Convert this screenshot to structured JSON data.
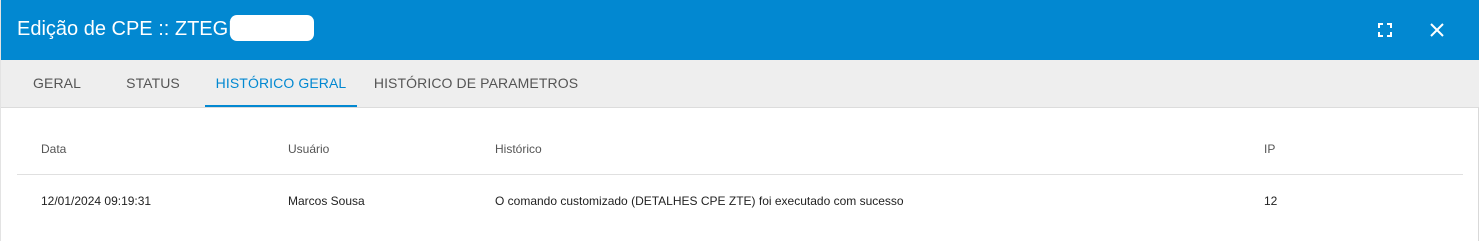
{
  "dialog": {
    "title": "Edição de CPE :: ZTEGD",
    "fullscreen_icon": "fullscreen-icon",
    "close_icon": "close-icon"
  },
  "tabs": [
    {
      "label": "GERAL",
      "active": false
    },
    {
      "label": "STATUS",
      "active": false
    },
    {
      "label": "HISTÓRICO GERAL",
      "active": true
    },
    {
      "label": "HISTÓRICO DE PARAMETROS",
      "active": false
    }
  ],
  "table": {
    "columns": [
      "Data",
      "Usuário",
      "Histórico",
      "IP"
    ],
    "rows": [
      {
        "date": "12/01/2024 09:19:31",
        "user": "Marcos Sousa",
        "history": "O comando customizado (DETALHES CPE ZTE) foi executado com sucesso",
        "ip": "12"
      }
    ]
  },
  "colors": {
    "header_bg": "#0288d1",
    "tabbar_bg": "#eeeeee",
    "accent": "#0288d1"
  }
}
